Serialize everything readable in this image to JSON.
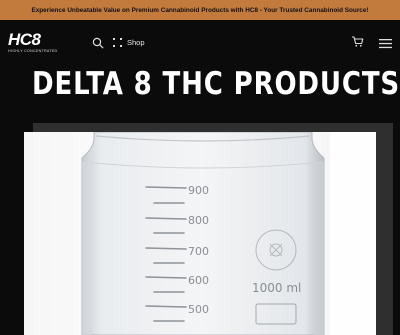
{
  "promo": {
    "text": "Experience Unbeatable Value on Premium Cannabinoid Products with HC8 - Your Trusted Cannabinoid Source!"
  },
  "header": {
    "logo_text": "HC8",
    "logo_tagline": "HIGHLY CONCENTRATED",
    "shop_label": "Shop"
  },
  "page": {
    "title": "DELTA 8 THC PRODUCTS"
  },
  "image": {
    "graduations": [
      "900",
      "800",
      "700",
      "600",
      "500"
    ],
    "volume_label": "1000 ml"
  },
  "colors": {
    "accent": "#c27a3d",
    "background": "#0b0b0b"
  },
  "icons": [
    "search-icon",
    "grid-icon",
    "cart-icon",
    "hamburger-menu-icon"
  ]
}
